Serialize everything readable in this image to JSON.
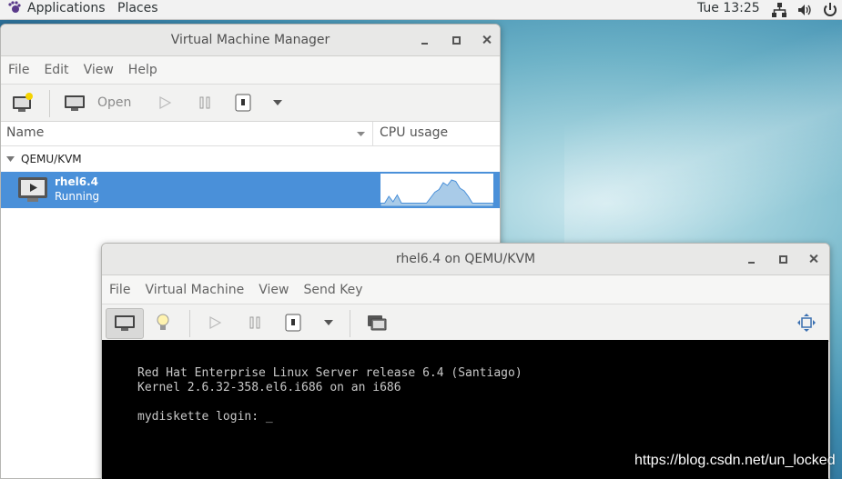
{
  "topbar": {
    "applications": "Applications",
    "places": "Places",
    "clock": "Tue 13:25",
    "tray_icons": [
      "network-icon",
      "volume-icon",
      "power-icon"
    ]
  },
  "manager": {
    "title": "Virtual Machine Manager",
    "menu": [
      "File",
      "Edit",
      "View",
      "Help"
    ],
    "toolbar": {
      "open_label": "Open",
      "icons": [
        "new-vm-icon",
        "monitor-icon",
        "play-icon",
        "pause-icon",
        "stop-icon",
        "dropdown-arrow-icon"
      ]
    },
    "columns": {
      "name": "Name",
      "cpu": "CPU usage"
    },
    "group": "QEMU/KVM",
    "vm": {
      "name": "rhel6.4",
      "status": "Running"
    },
    "cpu_graph": [
      0.05,
      0.05,
      0.3,
      0.1,
      0.35,
      0.05,
      0.05,
      0.05,
      0.05,
      0.05,
      0.05,
      0.05,
      0.25,
      0.45,
      0.55,
      0.8,
      0.7,
      0.9,
      0.85,
      0.6,
      0.5,
      0.3,
      0.05,
      0.05,
      0.05,
      0.05,
      0.05,
      0.05
    ]
  },
  "console": {
    "title": "rhel6.4 on QEMU/KVM",
    "menu": [
      "File",
      "Virtual Machine",
      "View",
      "Send Key"
    ],
    "toolbar_icons": [
      "console-icon",
      "details-bulb-icon",
      "play-icon",
      "pause-icon",
      "stop-icon",
      "dropdown-arrow-icon",
      "snapshot-icon",
      "fullscreen-icon"
    ],
    "terminal_lines": [
      "Red Hat Enterprise Linux Server release 6.4 (Santiago)",
      "Kernel 2.6.32-358.el6.i686 on an i686",
      "",
      "mydiskette login: _"
    ]
  },
  "watermark": "https://blog.csdn.net/un_locked",
  "colors": {
    "selection": "#4a90d9",
    "accent": "#4a90d9"
  }
}
